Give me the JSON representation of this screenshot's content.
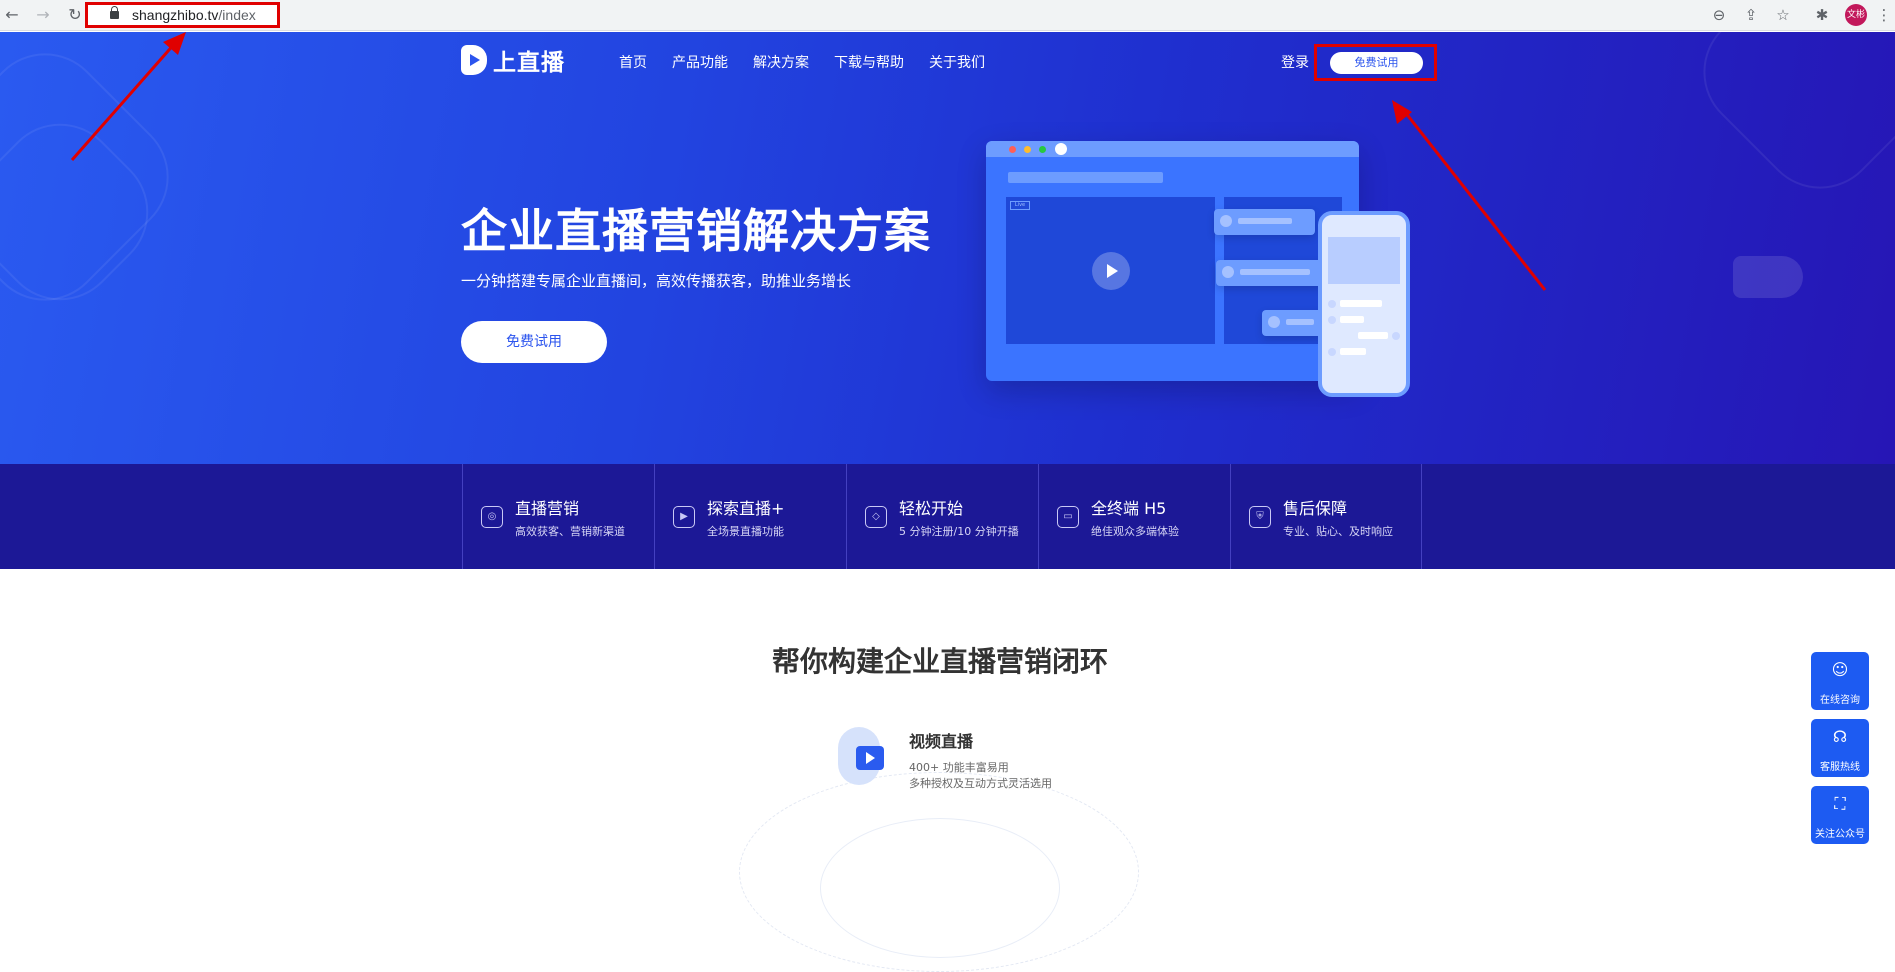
{
  "browser": {
    "url_host": "shangzhibo.tv",
    "url_path": "/index",
    "avatar_text": "文彬",
    "icons": [
      "back-icon",
      "forward-icon",
      "reload-icon",
      "lock-icon",
      "zoom-icon",
      "share-icon",
      "star-icon",
      "extensions-icon",
      "menu-icon"
    ]
  },
  "header": {
    "logo_text": "上直播",
    "nav": [
      "首页",
      "产品功能",
      "解决方案",
      "下载与帮助",
      "关于我们"
    ],
    "login_label": "登录",
    "trial_label": "免费试用"
  },
  "hero": {
    "title": "企业直播营销解决方案",
    "subtitle": "一分钟搭建专属企业直播间，高效传播获客，助推业务增长",
    "cta_label": "免费试用",
    "live_tag": "Live"
  },
  "features": [
    {
      "title": "直播营销",
      "desc": "高效获客、营销新渠道",
      "icon": "target-icon"
    },
    {
      "title": "探索直播+",
      "desc": "全场景直播功能",
      "icon": "play-square-icon"
    },
    {
      "title": "轻松开始",
      "desc": "5 分钟注册/10 分钟开播",
      "icon": "cube-icon"
    },
    {
      "title": "全终端 H5",
      "desc": "绝佳观众多端体验",
      "icon": "monitor-icon"
    },
    {
      "title": "售后保障",
      "desc": "专业、贴心、及时响应",
      "icon": "shield-icon"
    }
  ],
  "section": {
    "title": "帮你构建企业直播营销闭环",
    "product_name": "视频直播",
    "product_desc_1": "400+ 功能丰富易用",
    "product_desc_2": "多种授权及互动方式灵活选用"
  },
  "floating": [
    {
      "label": "在线咨询",
      "icon": "support-agent-icon"
    },
    {
      "label": "客服热线",
      "icon": "headset-icon"
    },
    {
      "label": "关注公众号",
      "icon": "qr-scan-icon"
    }
  ],
  "colors": {
    "brand_blue": "#2b54ee",
    "hero_gradient_start": "#2a5af0",
    "hero_gradient_end": "#2616b5",
    "features_bg": "#1c1896",
    "annotation_red": "#e00000"
  }
}
